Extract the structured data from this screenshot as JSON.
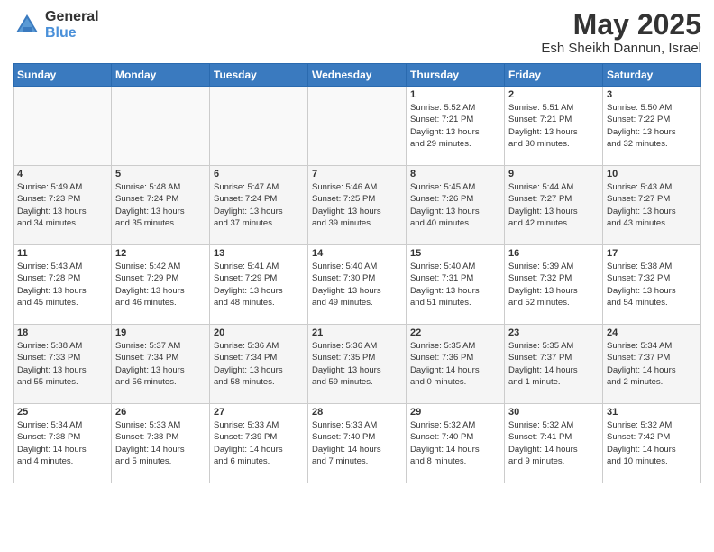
{
  "header": {
    "logo_general": "General",
    "logo_blue": "Blue",
    "month": "May 2025",
    "location": "Esh Sheikh Dannun, Israel"
  },
  "weekdays": [
    "Sunday",
    "Monday",
    "Tuesday",
    "Wednesday",
    "Thursday",
    "Friday",
    "Saturday"
  ],
  "weeks": [
    [
      {
        "day": "",
        "info": ""
      },
      {
        "day": "",
        "info": ""
      },
      {
        "day": "",
        "info": ""
      },
      {
        "day": "",
        "info": ""
      },
      {
        "day": "1",
        "info": "Sunrise: 5:52 AM\nSunset: 7:21 PM\nDaylight: 13 hours\nand 29 minutes."
      },
      {
        "day": "2",
        "info": "Sunrise: 5:51 AM\nSunset: 7:21 PM\nDaylight: 13 hours\nand 30 minutes."
      },
      {
        "day": "3",
        "info": "Sunrise: 5:50 AM\nSunset: 7:22 PM\nDaylight: 13 hours\nand 32 minutes."
      }
    ],
    [
      {
        "day": "4",
        "info": "Sunrise: 5:49 AM\nSunset: 7:23 PM\nDaylight: 13 hours\nand 34 minutes."
      },
      {
        "day": "5",
        "info": "Sunrise: 5:48 AM\nSunset: 7:24 PM\nDaylight: 13 hours\nand 35 minutes."
      },
      {
        "day": "6",
        "info": "Sunrise: 5:47 AM\nSunset: 7:24 PM\nDaylight: 13 hours\nand 37 minutes."
      },
      {
        "day": "7",
        "info": "Sunrise: 5:46 AM\nSunset: 7:25 PM\nDaylight: 13 hours\nand 39 minutes."
      },
      {
        "day": "8",
        "info": "Sunrise: 5:45 AM\nSunset: 7:26 PM\nDaylight: 13 hours\nand 40 minutes."
      },
      {
        "day": "9",
        "info": "Sunrise: 5:44 AM\nSunset: 7:27 PM\nDaylight: 13 hours\nand 42 minutes."
      },
      {
        "day": "10",
        "info": "Sunrise: 5:43 AM\nSunset: 7:27 PM\nDaylight: 13 hours\nand 43 minutes."
      }
    ],
    [
      {
        "day": "11",
        "info": "Sunrise: 5:43 AM\nSunset: 7:28 PM\nDaylight: 13 hours\nand 45 minutes."
      },
      {
        "day": "12",
        "info": "Sunrise: 5:42 AM\nSunset: 7:29 PM\nDaylight: 13 hours\nand 46 minutes."
      },
      {
        "day": "13",
        "info": "Sunrise: 5:41 AM\nSunset: 7:29 PM\nDaylight: 13 hours\nand 48 minutes."
      },
      {
        "day": "14",
        "info": "Sunrise: 5:40 AM\nSunset: 7:30 PM\nDaylight: 13 hours\nand 49 minutes."
      },
      {
        "day": "15",
        "info": "Sunrise: 5:40 AM\nSunset: 7:31 PM\nDaylight: 13 hours\nand 51 minutes."
      },
      {
        "day": "16",
        "info": "Sunrise: 5:39 AM\nSunset: 7:32 PM\nDaylight: 13 hours\nand 52 minutes."
      },
      {
        "day": "17",
        "info": "Sunrise: 5:38 AM\nSunset: 7:32 PM\nDaylight: 13 hours\nand 54 minutes."
      }
    ],
    [
      {
        "day": "18",
        "info": "Sunrise: 5:38 AM\nSunset: 7:33 PM\nDaylight: 13 hours\nand 55 minutes."
      },
      {
        "day": "19",
        "info": "Sunrise: 5:37 AM\nSunset: 7:34 PM\nDaylight: 13 hours\nand 56 minutes."
      },
      {
        "day": "20",
        "info": "Sunrise: 5:36 AM\nSunset: 7:34 PM\nDaylight: 13 hours\nand 58 minutes."
      },
      {
        "day": "21",
        "info": "Sunrise: 5:36 AM\nSunset: 7:35 PM\nDaylight: 13 hours\nand 59 minutes."
      },
      {
        "day": "22",
        "info": "Sunrise: 5:35 AM\nSunset: 7:36 PM\nDaylight: 14 hours\nand 0 minutes."
      },
      {
        "day": "23",
        "info": "Sunrise: 5:35 AM\nSunset: 7:37 PM\nDaylight: 14 hours\nand 1 minute."
      },
      {
        "day": "24",
        "info": "Sunrise: 5:34 AM\nSunset: 7:37 PM\nDaylight: 14 hours\nand 2 minutes."
      }
    ],
    [
      {
        "day": "25",
        "info": "Sunrise: 5:34 AM\nSunset: 7:38 PM\nDaylight: 14 hours\nand 4 minutes."
      },
      {
        "day": "26",
        "info": "Sunrise: 5:33 AM\nSunset: 7:38 PM\nDaylight: 14 hours\nand 5 minutes."
      },
      {
        "day": "27",
        "info": "Sunrise: 5:33 AM\nSunset: 7:39 PM\nDaylight: 14 hours\nand 6 minutes."
      },
      {
        "day": "28",
        "info": "Sunrise: 5:33 AM\nSunset: 7:40 PM\nDaylight: 14 hours\nand 7 minutes."
      },
      {
        "day": "29",
        "info": "Sunrise: 5:32 AM\nSunset: 7:40 PM\nDaylight: 14 hours\nand 8 minutes."
      },
      {
        "day": "30",
        "info": "Sunrise: 5:32 AM\nSunset: 7:41 PM\nDaylight: 14 hours\nand 9 minutes."
      },
      {
        "day": "31",
        "info": "Sunrise: 5:32 AM\nSunset: 7:42 PM\nDaylight: 14 hours\nand 10 minutes."
      }
    ]
  ]
}
